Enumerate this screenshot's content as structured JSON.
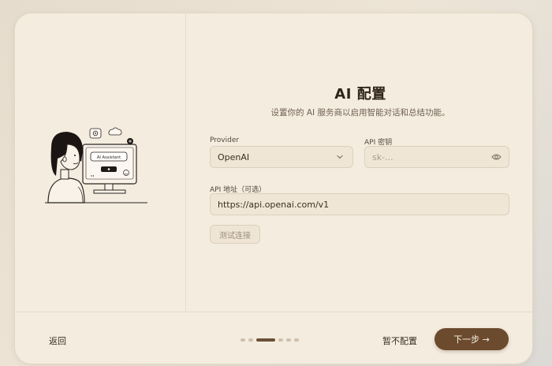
{
  "page": {
    "title": "AI 配置",
    "subtitle": "设置你的 AI 服务商以启用智能对话和总结功能。"
  },
  "illustration": {
    "screen_label": "AI Assistant"
  },
  "form": {
    "provider": {
      "label": "Provider",
      "value": "OpenAI"
    },
    "api_key": {
      "label": "API 密钥",
      "placeholder": "sk-..."
    },
    "api_url": {
      "label": "API 地址（可选）",
      "value": "https://api.openai.com/v1"
    },
    "test_button": "测试连接"
  },
  "footer": {
    "back": "返回",
    "skip": "暂不配置",
    "next": "下一步 →",
    "steps_total": 6,
    "current_step": 3
  },
  "colors": {
    "accent": "#6b4a2e",
    "card_bg": "#f4ecdf",
    "field_bg": "#f0e6d6"
  }
}
